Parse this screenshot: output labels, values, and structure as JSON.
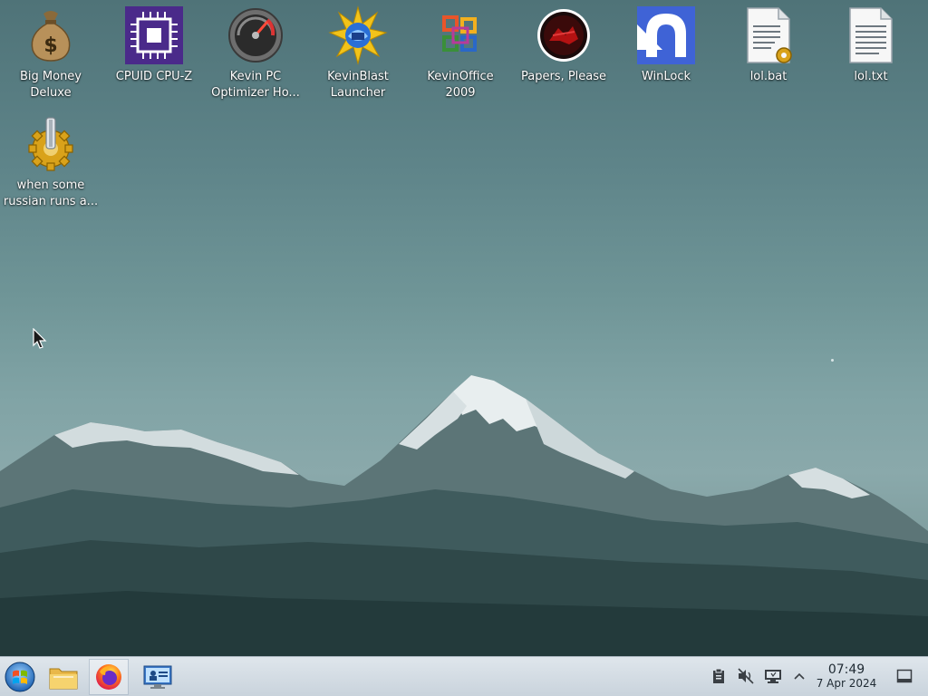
{
  "desktop": {
    "icons": [
      {
        "label": "Big Money Deluxe",
        "label_l1": "Big Money",
        "label_l2": "Deluxe",
        "icon": "money-bag-icon"
      },
      {
        "label": "CPUID CPU-Z",
        "label_l1": "CPUID CPU-Z",
        "icon": "cpu-chip-icon"
      },
      {
        "label": "Kevin PC Optimizer Ho...",
        "label_l1": "Kevin PC",
        "label_l2": "Optimizer Ho...",
        "icon": "speedometer-icon"
      },
      {
        "label": "KevinBlast Launcher",
        "label_l1": "KevinBlast",
        "label_l2": "Launcher",
        "icon": "starburst-icon"
      },
      {
        "label": "KevinOffice 2009",
        "label_l1": "KevinOffice",
        "label_l2": "2009",
        "icon": "office-logo-icon"
      },
      {
        "label": "Papers, Please",
        "label_l1": "Papers, Please",
        "icon": "papers-please-seal-icon"
      },
      {
        "label": "WinLock",
        "label_l1": "WinLock",
        "icon": "lock-arc-icon"
      },
      {
        "label": "lol.bat",
        "label_l1": "lol.bat",
        "icon": "batch-file-icon"
      },
      {
        "label": "lol.txt",
        "label_l1": "lol.txt",
        "icon": "text-file-icon"
      },
      {
        "label": "when some russian runs a...",
        "label_l1": "when some",
        "label_l2": "russian runs a...",
        "icon": "gear-icon"
      }
    ]
  },
  "taskbar": {
    "buttons": [
      {
        "name": "start-button",
        "icon": "windows-orb-icon"
      },
      {
        "name": "file-explorer",
        "icon": "folder-icon"
      },
      {
        "name": "firefox",
        "icon": "firefox-icon",
        "active": true
      },
      {
        "name": "control-panel",
        "icon": "monitor-user-icon"
      }
    ],
    "tray": {
      "icons": [
        "clipboard-icon",
        "volume-muted-icon",
        "network-icon",
        "chevron-up-icon"
      ],
      "clock_time": "07:49",
      "clock_date": "7 Apr 2024",
      "show_desktop_icon": "show-desktop-icon"
    }
  },
  "colors": {
    "sky_top": "#4f7378",
    "sky_mid": "#80a3a5",
    "taskbar_bg": "#d3dce4",
    "label_text": "#ffffff"
  }
}
